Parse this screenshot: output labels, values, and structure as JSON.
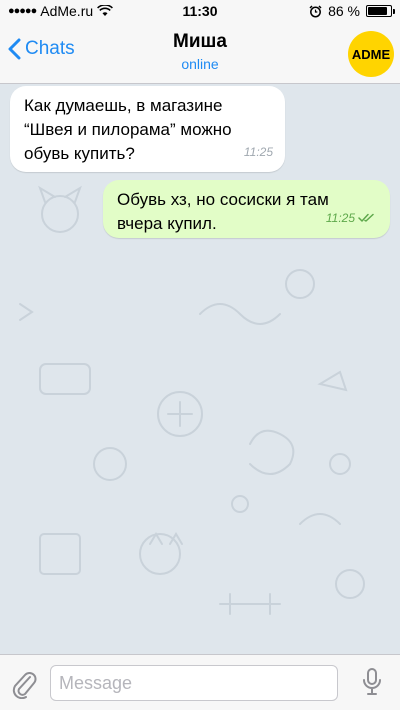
{
  "status_bar": {
    "carrier": "AdMe.ru",
    "time": "11:30",
    "battery": "86 %",
    "battery_level": 0.86
  },
  "header": {
    "back_label": "Chats",
    "contact_name": "Миша",
    "contact_status": "online",
    "avatar_text": "ADME"
  },
  "messages": [
    {
      "direction": "incoming",
      "text": "Как думаешь, в магазине “Швея и пилорама” можно обувь купить?",
      "time": "11:25"
    },
    {
      "direction": "outgoing",
      "text": "Обувь хз, но сосиски я там вчера купил.",
      "time": "11:25",
      "read_receipt": "double-check-icon"
    }
  ],
  "input": {
    "placeholder": "Message"
  },
  "colors": {
    "accent": "#1f8bf3",
    "outgoing_bubble": "#e2fdc7",
    "incoming_bubble": "#ffffff",
    "chat_background": "#dfe6ec",
    "avatar": "#ffd400"
  }
}
